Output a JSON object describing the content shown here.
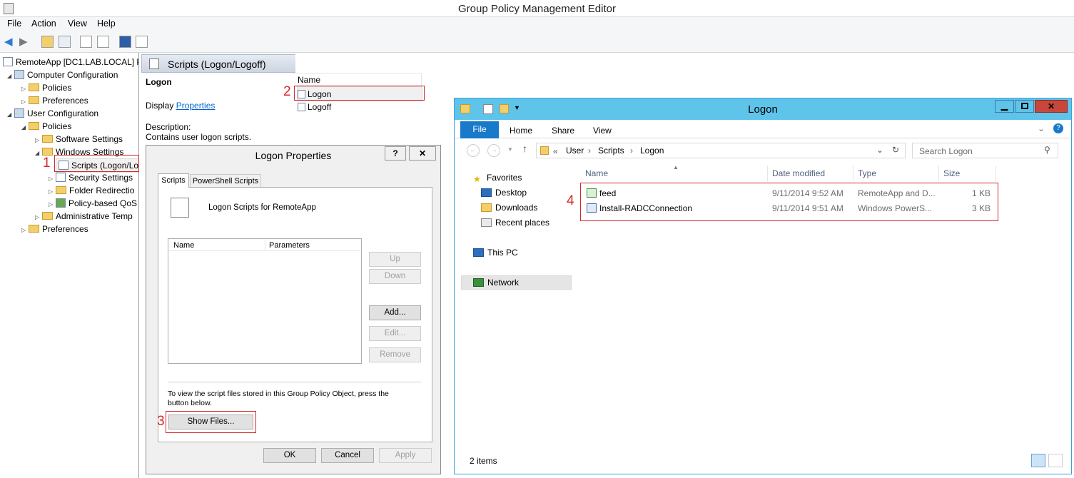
{
  "app": {
    "title": "Group Policy Management Editor",
    "menu": [
      "File",
      "Action",
      "View",
      "Help"
    ]
  },
  "tree": {
    "root": "RemoteApp [DC1.LAB.LOCAL] P",
    "computer_config": "Computer Configuration",
    "cc_policies": "Policies",
    "cc_preferences": "Preferences",
    "user_config": "User Configuration",
    "uc_policies": "Policies",
    "software_settings": "Software Settings",
    "windows_settings": "Windows Settings",
    "scripts": "Scripts (Logon/Lo",
    "security_settings": "Security Settings",
    "folder_redirection": "Folder Redirectio",
    "policy_qos": "Policy-based QoS",
    "admin_templates": "Administrative Temp",
    "uc_preferences": "Preferences"
  },
  "details": {
    "header": "Scripts (Logon/Logoff)",
    "selected": "Logon",
    "display_prefix": "Display ",
    "properties_link": "Properties",
    "description_label": "Description:",
    "description": "Contains user logon scripts.",
    "name_col": "Name",
    "items": [
      "Logon",
      "Logoff"
    ]
  },
  "dialog": {
    "title": "Logon Properties",
    "help": "?",
    "close": "✕",
    "tabs": [
      "Scripts",
      "PowerShell Scripts"
    ],
    "heading": "Logon Scripts for RemoteApp",
    "cols": [
      "Name",
      "Parameters"
    ],
    "up": "Up",
    "down": "Down",
    "add": "Add...",
    "edit": "Edit...",
    "remove": "Remove",
    "hint": "To view the script files stored in this Group Policy Object, press the button below.",
    "show_files": "Show Files...",
    "ok": "OK",
    "cancel": "Cancel",
    "apply": "Apply"
  },
  "explorer": {
    "title": "Logon",
    "ribbon": [
      "File",
      "Home",
      "Share",
      "View"
    ],
    "breadcrumb": {
      "prefix": "«",
      "parts": [
        "User",
        "Scripts",
        "Logon"
      ]
    },
    "search_placeholder": "Search Logon",
    "nav": {
      "favorites": "Favorites",
      "desktop": "Desktop",
      "downloads": "Downloads",
      "recent": "Recent places",
      "thispc": "This PC",
      "network": "Network"
    },
    "cols": [
      "Name",
      "Date modified",
      "Type",
      "Size"
    ],
    "files": [
      {
        "name": "feed",
        "date": "9/11/2014 9:52 AM",
        "type": "RemoteApp and D...",
        "size": "1 KB"
      },
      {
        "name": "Install-RADCConnection",
        "date": "9/11/2014 9:51 AM",
        "type": "Windows PowerS...",
        "size": "3 KB"
      }
    ],
    "status": "2 items"
  },
  "annotations": [
    "1",
    "2",
    "3",
    "4"
  ],
  "colors": {
    "accent": "#0066cc",
    "annotation": "#d62828",
    "explorer_title": "#5fc4ea",
    "file_tab": "#1979ca"
  }
}
